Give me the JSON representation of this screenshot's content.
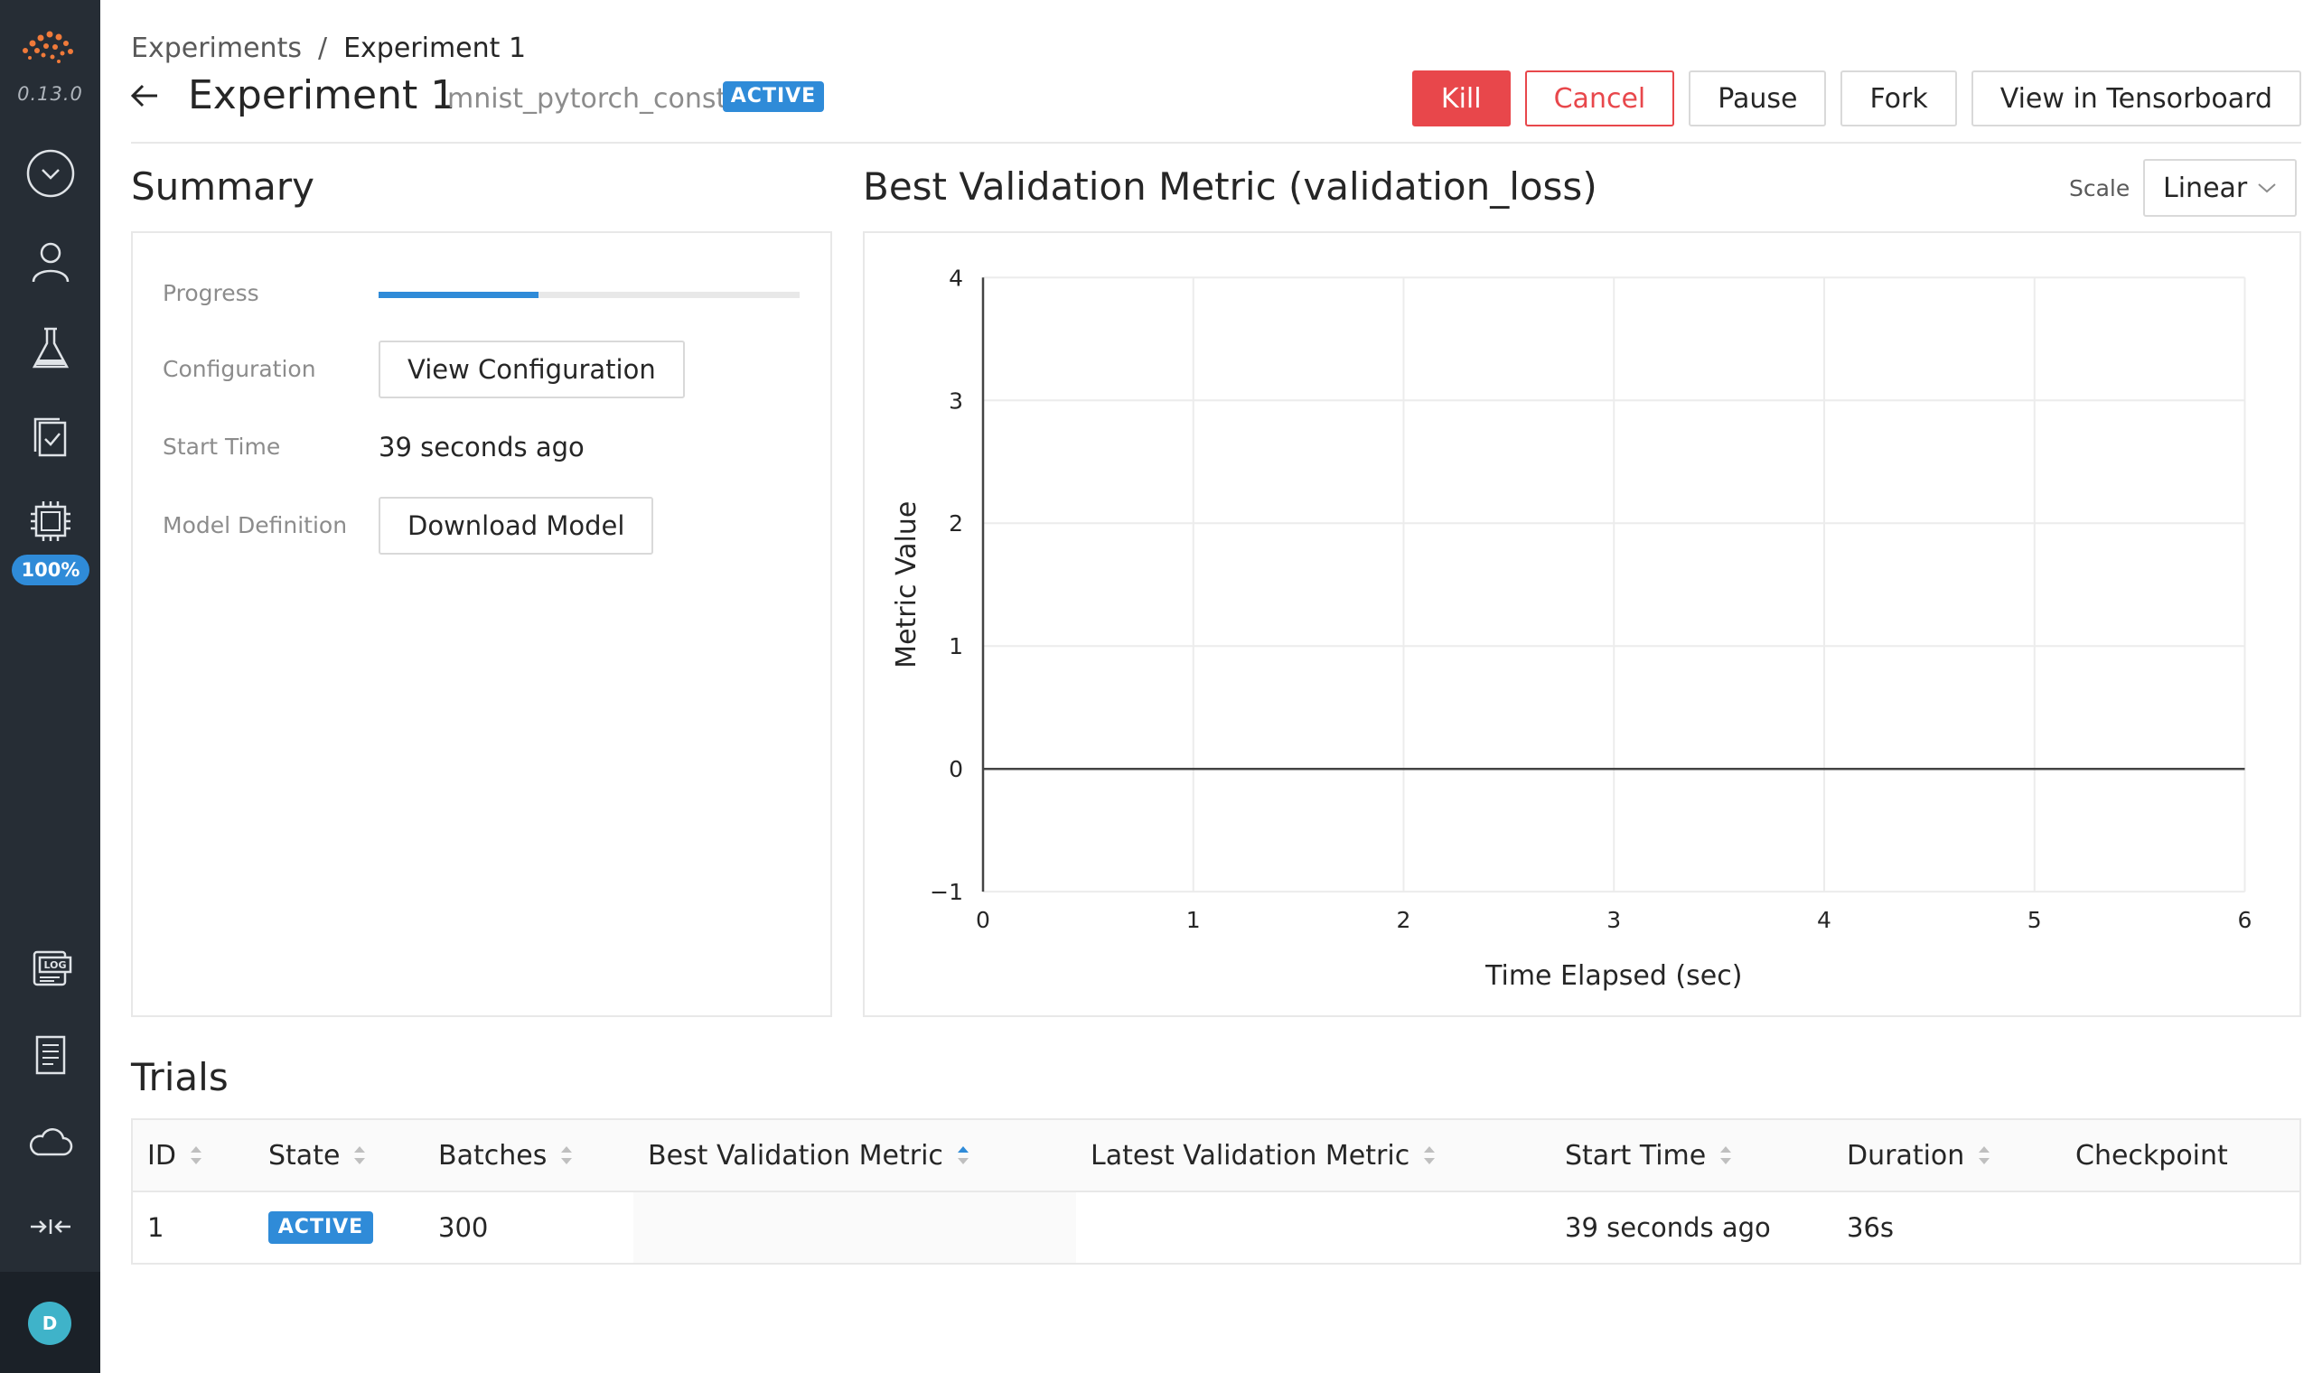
{
  "app": {
    "version": "0.13.0",
    "cluster_utilization": "100%",
    "user_initial": "D",
    "nav_items": [
      {
        "name": "dashboard-nav",
        "icon": "chevron-down-circle-icon"
      },
      {
        "name": "user-nav",
        "icon": "user-icon"
      },
      {
        "name": "experiments-nav",
        "icon": "flask-icon"
      },
      {
        "name": "tasks-nav",
        "icon": "task-check-icon"
      },
      {
        "name": "cluster-nav",
        "icon": "cpu-icon"
      },
      {
        "name": "master-logs-nav",
        "icon": "log-icon"
      },
      {
        "name": "docs-nav",
        "icon": "document-icon"
      },
      {
        "name": "api-nav",
        "icon": "cloud-icon"
      },
      {
        "name": "collapse-nav",
        "icon": "collapse-arrows-icon"
      }
    ],
    "colors": {
      "accent": "#2f8bd8",
      "danger": "#e8474b",
      "sidebar": "#262d35",
      "logo": "#f07a3a"
    }
  },
  "breadcrumb": {
    "parent": "Experiments",
    "separator": "/",
    "current": "Experiment 1"
  },
  "header": {
    "title": "Experiment 1",
    "subtitle": "mnist_pytorch_const",
    "state": "ACTIVE",
    "actions": {
      "kill": "Kill",
      "cancel": "Cancel",
      "pause": "Pause",
      "fork": "Fork",
      "tensorboard": "View in Tensorboard"
    }
  },
  "summary": {
    "title": "Summary",
    "progress_label": "Progress",
    "progress_value": 0.38,
    "configuration_label": "Configuration",
    "configuration_button": "View Configuration",
    "start_time_label": "Start Time",
    "start_time_value": "39 seconds ago",
    "model_definition_label": "Model Definition",
    "model_definition_button": "Download Model"
  },
  "chart_panel": {
    "title": "Best Validation Metric (validation_loss)",
    "scale_label": "Scale",
    "scale_value": "Linear"
  },
  "chart_data": {
    "type": "line",
    "title": "Best Validation Metric (validation_loss)",
    "xlabel": "Time Elapsed (sec)",
    "ylabel": "Metric Value",
    "xlim": [
      0,
      6
    ],
    "ylim": [
      -1,
      4
    ],
    "x_ticks": [
      "0",
      "1",
      "2",
      "3",
      "4",
      "5",
      "6"
    ],
    "y_ticks": [
      "−1",
      "0",
      "1",
      "2",
      "3",
      "4"
    ],
    "grid": true,
    "series": []
  },
  "trials": {
    "title": "Trials",
    "columns": [
      "ID",
      "State",
      "Batches",
      "Best Validation Metric",
      "Latest Validation Metric",
      "Start Time",
      "Duration",
      "Checkpoint"
    ],
    "rows": [
      {
        "id": "1",
        "state": "ACTIVE",
        "batches": "300",
        "best_metric": "",
        "latest_metric": "",
        "start_time": "39 seconds ago",
        "duration": "36s",
        "checkpoint": ""
      }
    ]
  }
}
